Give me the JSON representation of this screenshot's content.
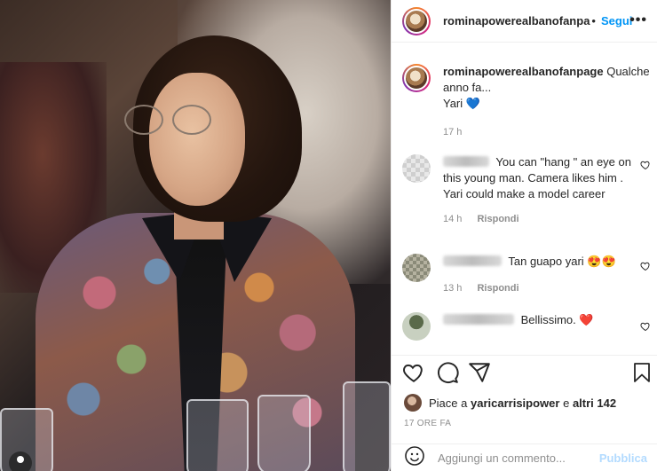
{
  "post": {
    "username": "rominapowerealbanofanpa",
    "follow_label": "Segui",
    "more_label": "•••",
    "caption": {
      "username": "rominapowerealbanofanpage",
      "line1": "Qualche",
      "line2": "anno fa...",
      "line3": "Yari",
      "emoji": "💙",
      "time": "17 h"
    },
    "comments": [
      {
        "text": "You can \"hang \" an eye on this young man. Camera likes him . Yari could make a model career",
        "time": "14 h",
        "reply_label": "Rispondi"
      },
      {
        "text": "Tan guapo yari 😍😍",
        "time": "13 h",
        "reply_label": "Rispondi"
      },
      {
        "text": "Bellissimo.",
        "emoji": "❤️"
      }
    ],
    "likes": {
      "prefix": "Piace a",
      "user": "yaricarrisipower",
      "conj": "e",
      "others": "altri 142"
    },
    "timestamp": "17 ORE FA",
    "add_comment_placeholder": "Aggiungi un commento...",
    "publish_label": "Pubblica"
  },
  "colors": {
    "accent": "#0095f6",
    "muted": "#8e8e8e",
    "publish_disabled": "#b3dbff"
  },
  "icons": [
    "heart-icon",
    "comment-icon",
    "share-icon",
    "bookmark-icon",
    "more-icon",
    "emoji-icon",
    "user-icon"
  ]
}
